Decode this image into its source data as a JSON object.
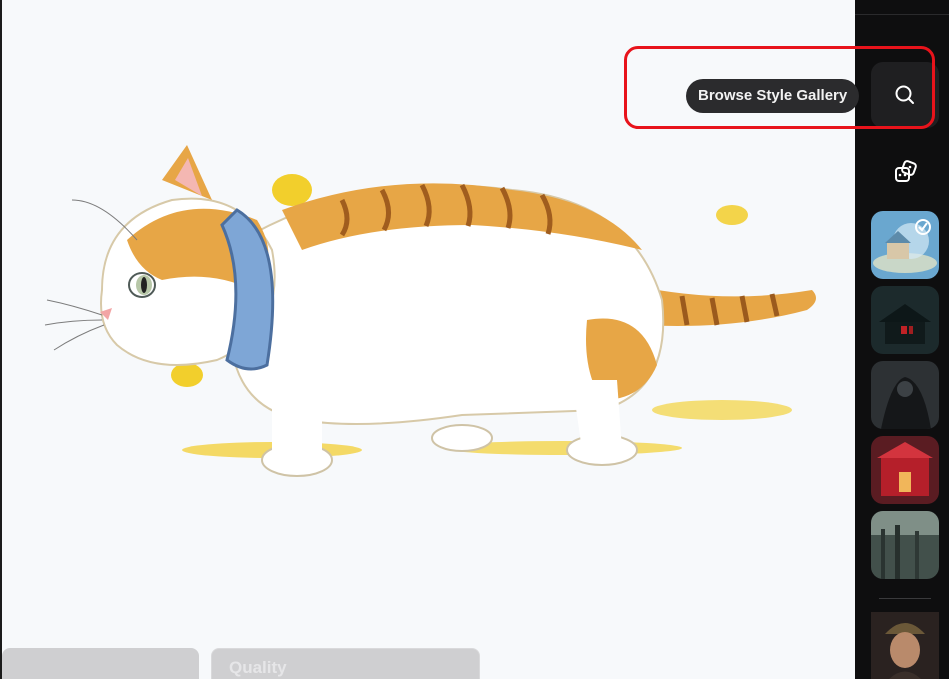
{
  "tooltip": {
    "text": "Browse Style Gallery"
  },
  "bottom_panel": {
    "card_two_label": "Quality"
  },
  "sidebar": {
    "buttons": [
      {
        "icon": "search-icon"
      },
      {
        "icon": "dice-icon"
      }
    ],
    "style_thumbnails": [
      {
        "selected": true,
        "icon": "check-icon"
      },
      {
        "selected": false
      },
      {
        "selected": false
      },
      {
        "selected": false
      },
      {
        "selected": false
      }
    ]
  },
  "annotation": {
    "color": "#e8131b"
  }
}
